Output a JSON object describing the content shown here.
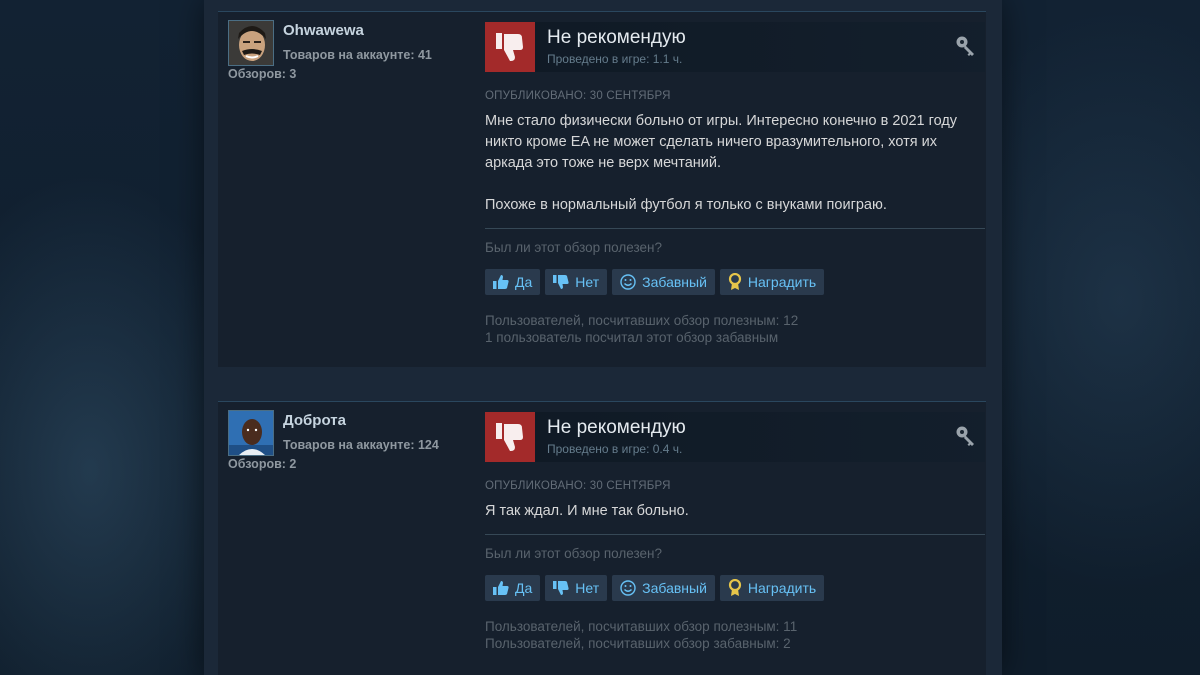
{
  "reviews": [
    {
      "author": "Ohwawewa",
      "products": "Товаров на аккаунте: 41",
      "review_count": "Обзоров: 3",
      "verdict": "Не рекомендую",
      "hours": "Проведено в игре: 1.1 ч.",
      "posted": "ОПУБЛИКОВАНО: 30 СЕНТЯБРЯ",
      "text": "Мне стало физически больно от игры. Интересно конечно в 2021 году никто кроме EA не может сделать ничего вразумительного, хотя их аркада это тоже не верх мечтаний.\n\nПохоже в нормальный футбол я только с внуками поиграю.",
      "helpful_question": "Был ли этот обзор полезен?",
      "buttons": {
        "yes": "Да",
        "no": "Нет",
        "funny": "Забавный",
        "award": "Наградить"
      },
      "helpful_stat": "Пользователей, посчитавших обзор полезным: 12",
      "funny_stat": "1 пользователь посчитал этот обзор забавным"
    },
    {
      "author": "Доброта",
      "products": "Товаров на аккаунте: 124",
      "review_count": "Обзоров: 2",
      "verdict": "Не рекомендую",
      "hours": "Проведено в игре: 0.4 ч.",
      "posted": "ОПУБЛИКОВАНО: 30 СЕНТЯБРЯ",
      "text": "Я так ждал. И мне так больно.",
      "helpful_question": "Был ли этот обзор полезен?",
      "buttons": {
        "yes": "Да",
        "no": "Нет",
        "funny": "Забавный",
        "award": "Наградить"
      },
      "helpful_stat": "Пользователей, посчитавших обзор полезным: 11",
      "funny_stat": "Пользователей, посчитавших обзор забавным: 2"
    }
  ],
  "colors": {
    "thumb_down_bg": "#a32a2a",
    "button_text": "#67c1f5",
    "award_icon": "#e6c54a"
  },
  "icons": {
    "verdict": "thumbs-down-icon",
    "key": "key-icon",
    "yes": "thumbs-up-icon",
    "no": "thumbs-down-icon",
    "funny": "smile-icon",
    "award": "award-icon"
  }
}
